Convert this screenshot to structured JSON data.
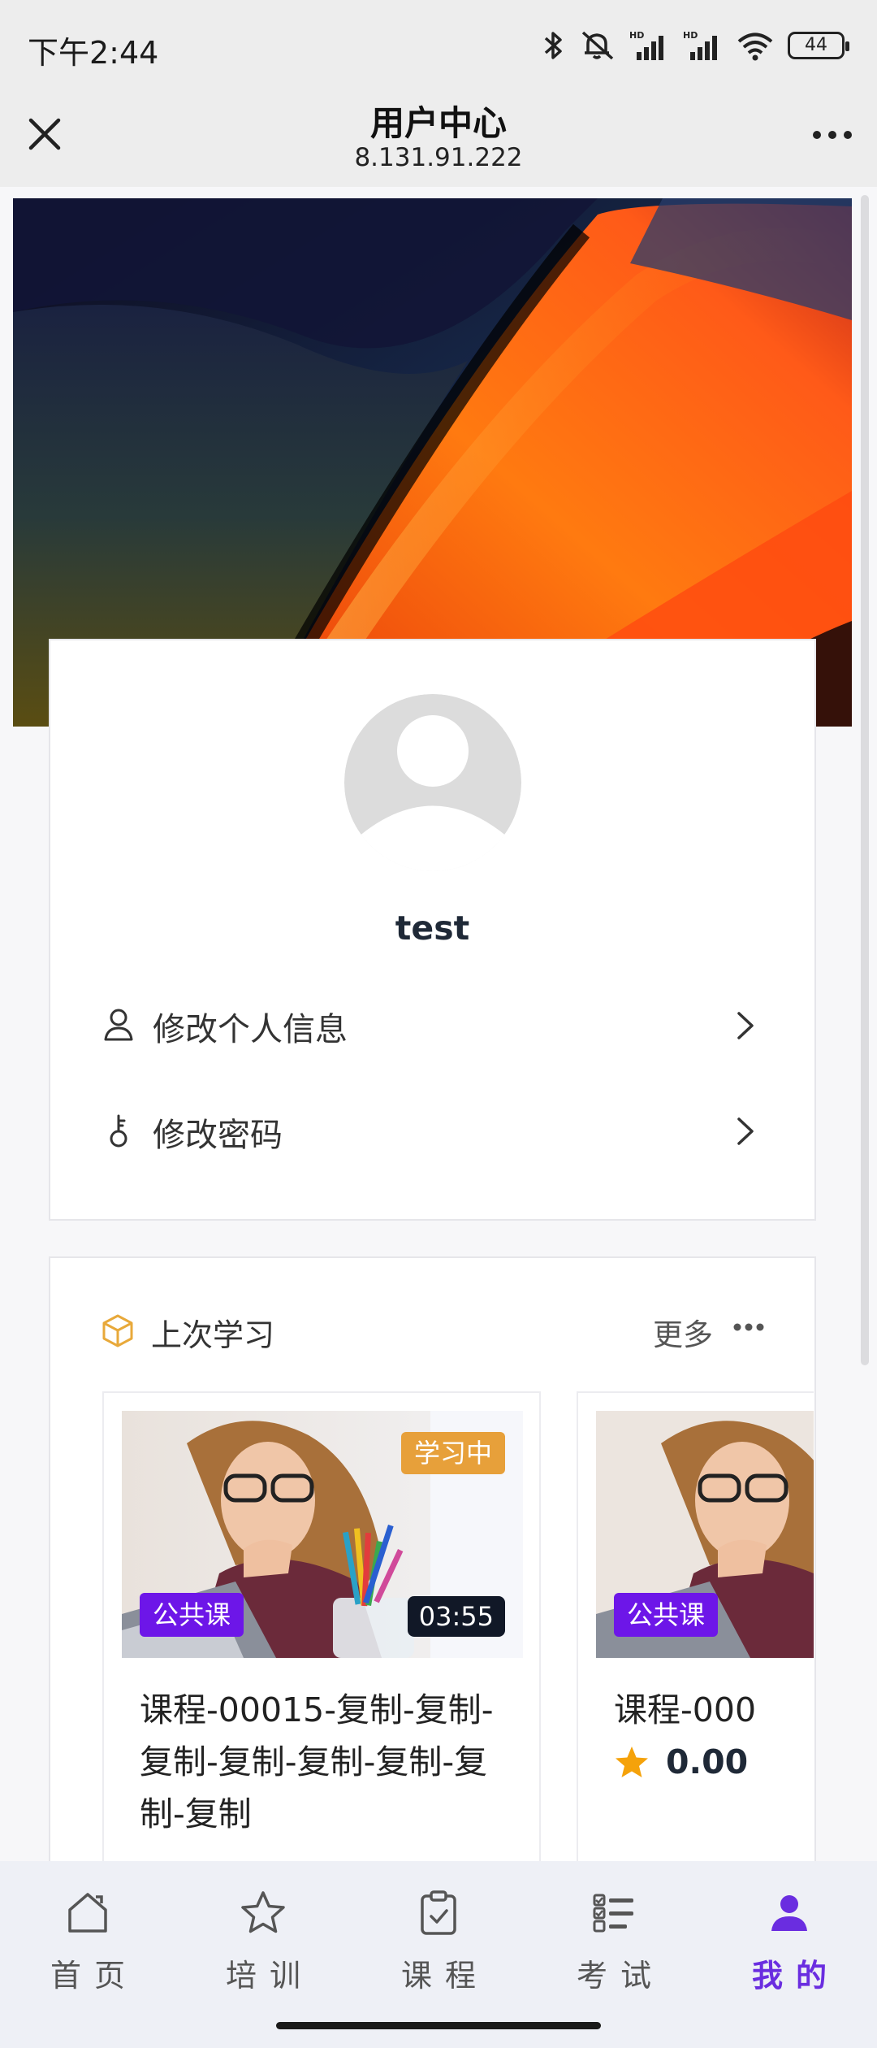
{
  "status_bar": {
    "time": "下午2:44",
    "battery": "44",
    "icons": [
      "bluetooth-icon",
      "mute-icon",
      "signal-hd-icon",
      "signal-hd-icon",
      "wifi-icon",
      "battery-icon"
    ]
  },
  "nav": {
    "title": "用户中心",
    "subtitle": "8.131.91.222",
    "close_icon": "close-icon",
    "more_icon": "more-icon"
  },
  "profile": {
    "username": "test",
    "menu": [
      {
        "label": "修改个人信息",
        "icon": "user-icon"
      },
      {
        "label": "修改密码",
        "icon": "key-icon"
      }
    ]
  },
  "recent_learning": {
    "title": "上次学习",
    "more": "更多",
    "courses": [
      {
        "status": "学习中",
        "type": "公共课",
        "duration": "03:55",
        "title": "课程-00015-复制-复制-复制-复制-复制-复制-复制-复制"
      },
      {
        "type": "公共课",
        "title": "课程-000",
        "rating": "0.00"
      }
    ]
  },
  "tabs": [
    {
      "label": "首页",
      "icon": "home-icon",
      "active": false
    },
    {
      "label": "培训",
      "icon": "star-icon",
      "active": false
    },
    {
      "label": "课程",
      "icon": "clipboard-icon",
      "active": false
    },
    {
      "label": "考试",
      "icon": "checklist-icon",
      "active": false
    },
    {
      "label": "我的",
      "icon": "person-icon",
      "active": true
    }
  ],
  "colors": {
    "accent": "#6a2de0",
    "status_tag": "#e7a03a",
    "type_tag": "#6d16e8",
    "rating_star": "#f5a20a"
  }
}
